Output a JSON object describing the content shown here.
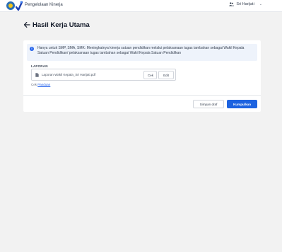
{
  "app": {
    "name": "Pengelolaan Kinerja"
  },
  "user": {
    "name": "Sri Harijati"
  },
  "page": {
    "title": "Hasil Kerja Utama"
  },
  "notice": {
    "text": "Hanya untuk SMP, SMA, SMK: Meningkatnya kinerja satuan pendidikan melalui pelaksanaan tugas tambahan sebagai Wakil Kepala Satuan Pendidikan/ pelaksanaan tugas tambahan sebagai Wakil Kepala Satuan Pendidikan"
  },
  "laporan": {
    "label": "LAPORAN",
    "file_name": "Laporan Wakil Kepala_Sri Harijati.pdf",
    "cek_label": "Cek",
    "edit_label": "Edit",
    "help_prefix": "Cek",
    "help_link": "Panduan"
  },
  "actions": {
    "draft_label": "Simpan draf",
    "submit_label": "Kumpulkan"
  },
  "colors": {
    "accent": "#1d63e0",
    "notice_bg": "#eef3fb",
    "page_bg": "#f2f2f2"
  },
  "icons": [
    "kemdikbud-logo-icon",
    "app-logo-icon",
    "user-group-icon",
    "chevron-down-icon",
    "back-arrow-icon",
    "info-icon",
    "document-icon"
  ]
}
